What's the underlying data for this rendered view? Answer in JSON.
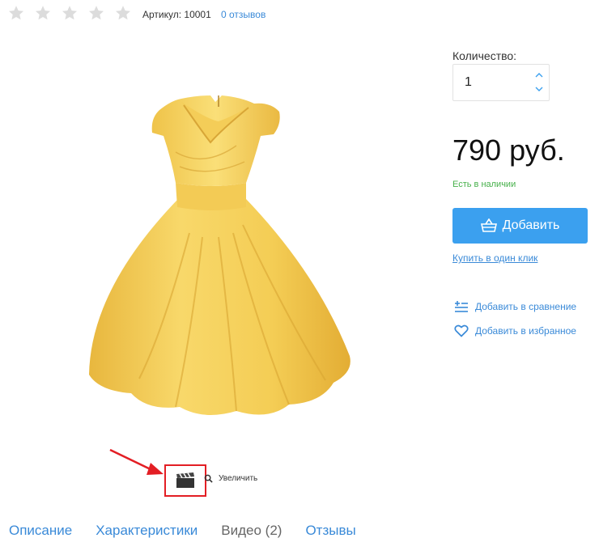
{
  "rating": {
    "stars_filled": 0,
    "stars_total": 5
  },
  "sku": "Артикул:  10001",
  "reviews": "0 отзывов",
  "zoom_label": "Увеличить",
  "tabs": [
    {
      "label": "Описание"
    },
    {
      "label": "Характеристики"
    },
    {
      "label": "Видео (2)"
    },
    {
      "label": "Отзывы"
    }
  ],
  "quantity": {
    "label": "Количество:",
    "value": "1"
  },
  "price": "790 руб.",
  "stock": "Есть в наличии",
  "add_button": "Добавить",
  "one_click": "Купить в один клик",
  "compare": "Добавить в сравнение",
  "favorites": "Добавить в избранное",
  "colors": {
    "accent": "#3ba0ef",
    "link": "#3a8ad8",
    "in_stock": "#46b04a",
    "highlight": "#e31e24",
    "dress": "#f6d35f"
  }
}
